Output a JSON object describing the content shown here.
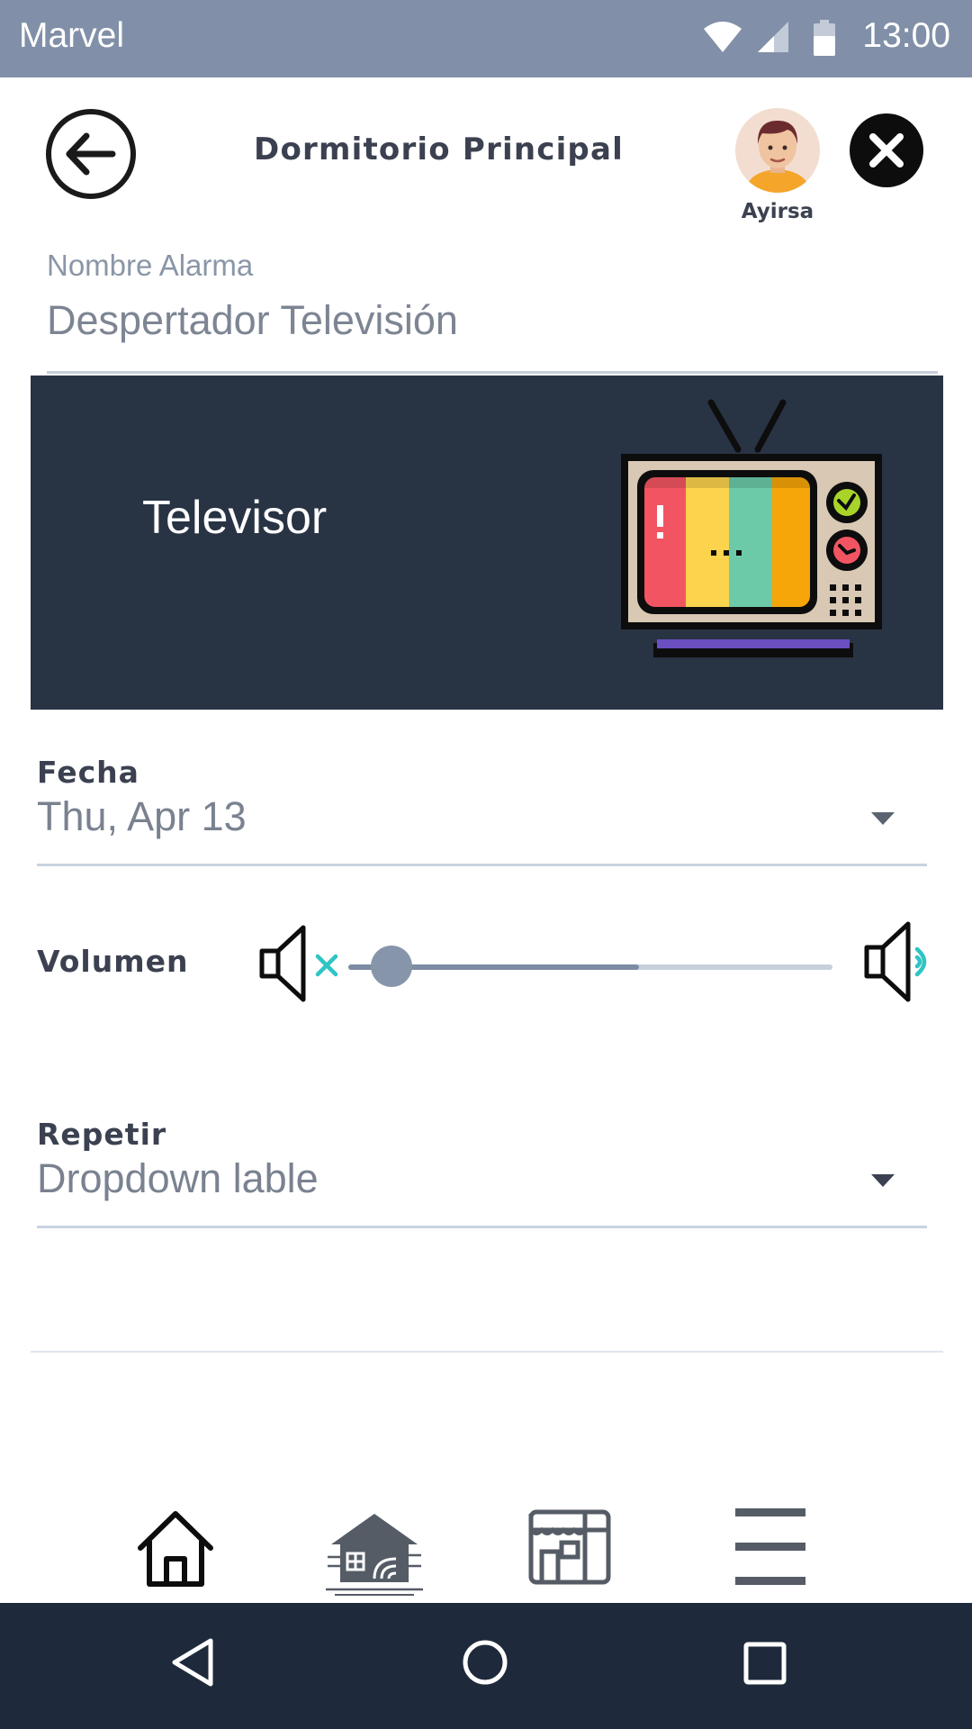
{
  "status_bar": {
    "app_name": "Marvel",
    "time": "13:00"
  },
  "header": {
    "title": "Dormitorio Principal",
    "user_name": "Ayirsa"
  },
  "alarm_name": {
    "label": "Nombre Alarma",
    "value": "Despertador Televisión"
  },
  "device": {
    "name": "Televisor"
  },
  "date": {
    "label": "Fecha",
    "value": "Thu, Apr 13"
  },
  "volume": {
    "label": "Volumen",
    "level": 0.09,
    "buffered": 0.6
  },
  "repeat": {
    "label": "Repetir",
    "value": "Dropdown lable"
  },
  "bottom_nav": {
    "items": [
      {
        "icon": "home-icon"
      },
      {
        "icon": "smart-home-icon"
      },
      {
        "icon": "store-icon"
      },
      {
        "icon": "menu-icon"
      }
    ]
  },
  "colors": {
    "status_bar": "#8190a8",
    "card_bg": "#283344",
    "accent_teal": "#2fc4c4",
    "android_nav": "#1e2a3b",
    "slider_thumb": "#8795ab"
  }
}
